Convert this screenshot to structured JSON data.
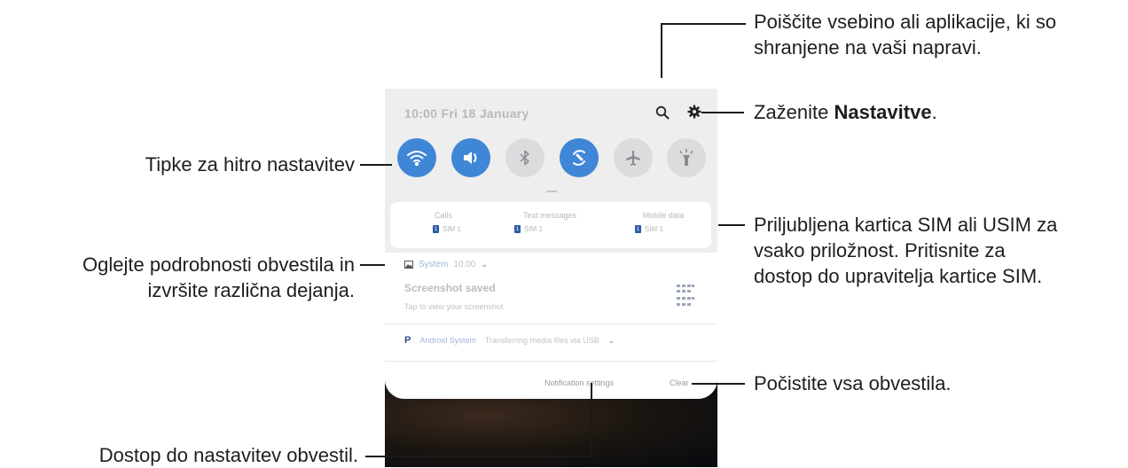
{
  "panel": {
    "status_time": "10:00  Fri 18 January",
    "quick_buttons": [
      {
        "icon": "wifi-icon",
        "state": "on"
      },
      {
        "icon": "sound-icon",
        "state": "on"
      },
      {
        "icon": "bluetooth-icon",
        "state": "off"
      },
      {
        "icon": "auto-rotate-icon",
        "state": "on"
      },
      {
        "icon": "airplane-icon",
        "state": "off"
      },
      {
        "icon": "flashlight-icon",
        "state": "off"
      }
    ],
    "sim": [
      {
        "label": "Calls",
        "sim": "SIM 1"
      },
      {
        "label": "Text messages",
        "sim": "SIM 1"
      },
      {
        "label": "Mobile data",
        "sim": "SIM 1"
      }
    ],
    "sim_badge": "1",
    "notification": {
      "app": "System",
      "time": "10:00",
      "title": "Screenshot saved",
      "body": "Tap to view your screenshot"
    },
    "android_system": {
      "badge": "P",
      "app": "Android System",
      "text": "Transferring media files via USB"
    },
    "notification_settings_label": "Notification settings",
    "clear_label": "Clear"
  },
  "callouts": {
    "search_line1": "Poiščite vsebino ali aplikacije, ki so",
    "search_line2": "shranjene na vaši napravi.",
    "settings_prefix": "Zaženite ",
    "settings_bold": "Nastavitve",
    "settings_suffix": ".",
    "quick": "Tipke za hitro nastavitev",
    "details_line1": "Oglejte podrobnosti obvestila in",
    "details_line2": "izvršite različna dejanja.",
    "sim_line1": "Priljubljena kartica SIM ali USIM za",
    "sim_line2": "vsako priložnost. Pritisnite za",
    "sim_line3": "dostop do upravitelja kartice SIM.",
    "clear": "Počistite vsa obvestila.",
    "notif_settings": "Dostop do nastavitev obvestil."
  },
  "colors": {
    "accent": "#3f86d6",
    "sim_badge": "#2d5ba8"
  }
}
